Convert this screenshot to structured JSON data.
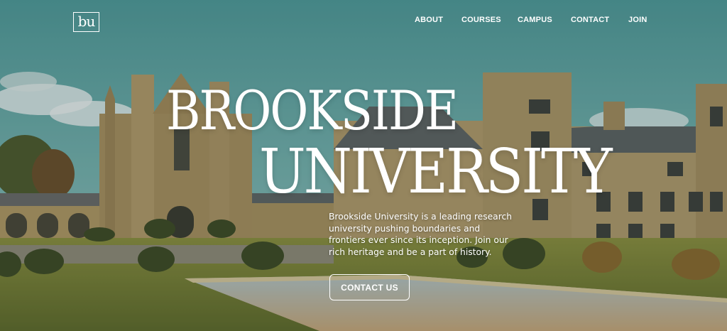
{
  "brand": {
    "logo_text": "bu"
  },
  "nav": {
    "items": [
      {
        "label": "ABOUT"
      },
      {
        "label": "COURSES"
      },
      {
        "label": "CAMPUS"
      },
      {
        "label": "CONTACT"
      },
      {
        "label": "JOIN"
      }
    ]
  },
  "hero": {
    "title_line1": "BROOKSIDE",
    "title_line2": "UNIVERSITY",
    "description": "Brookside University is a leading research university pushing boundaries and frontiers ever since its inception. Join our rich heritage and be a part of history.",
    "cta_label": "CONTACT US",
    "background": "campus-photo"
  },
  "colors": {
    "sky": "#5fa3a3",
    "stone": "#b39a6a",
    "roof": "#5e6363",
    "lawn": "#7b8a3a",
    "water": "#9fb2b8",
    "text": "#ffffff"
  }
}
